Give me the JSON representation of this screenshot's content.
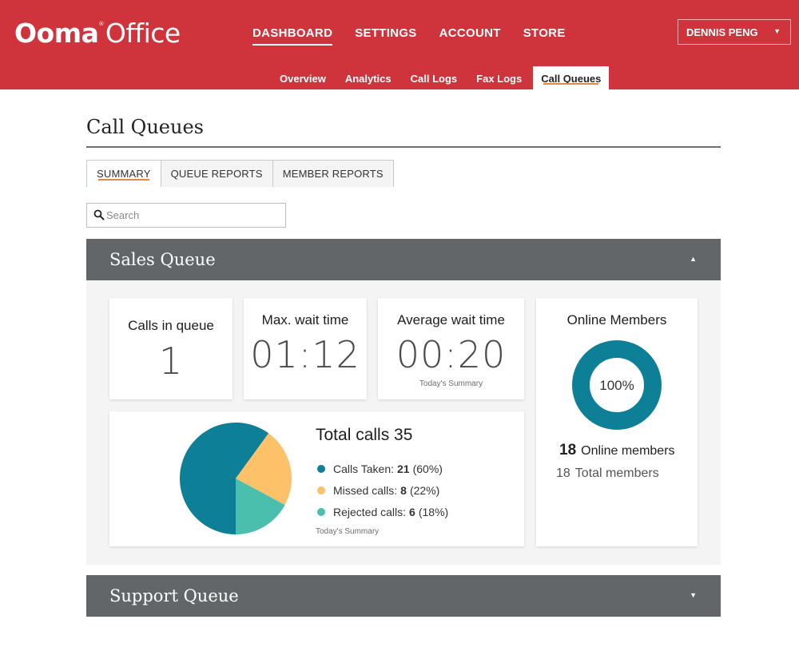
{
  "header": {
    "logo_brand": "Ooma",
    "logo_reg": "®",
    "logo_product": "Office",
    "main_nav": [
      {
        "label": "DASHBOARD",
        "active": true
      },
      {
        "label": "SETTINGS",
        "active": false
      },
      {
        "label": "ACCOUNT",
        "active": false
      },
      {
        "label": "STORE",
        "active": false
      }
    ],
    "user_menu": {
      "label": "DENNIS PENG",
      "caret": "▼"
    },
    "sub_nav": [
      {
        "label": "Overview",
        "active": false
      },
      {
        "label": "Analytics",
        "active": false
      },
      {
        "label": "Call Logs",
        "active": false
      },
      {
        "label": "Fax Logs",
        "active": false
      },
      {
        "label": "Call Queues",
        "active": true
      }
    ]
  },
  "page": {
    "title": "Call Queues",
    "tabs": [
      {
        "label": "SUMMARY",
        "active": true
      },
      {
        "label": "QUEUE REPORTS",
        "active": false
      },
      {
        "label": "MEMBER REPORTS",
        "active": false
      }
    ],
    "search": {
      "placeholder": "Search",
      "value": ""
    }
  },
  "queues": [
    {
      "name": "Sales Queue",
      "expanded": true,
      "toggle_icon": "▲",
      "stats": {
        "calls_in_queue": {
          "label": "Calls in queue",
          "value": "1"
        },
        "max_wait": {
          "label": "Max. wait time",
          "value": "01:12"
        },
        "avg_wait": {
          "label": "Average wait time",
          "value": "00:20",
          "note": "Today's Summary"
        }
      },
      "online_members": {
        "title": "Online Members",
        "percent_label": "100%",
        "online_fraction": 1.0,
        "online_count": "18",
        "online_label": "Online members",
        "total_count": "18",
        "total_label": "Total members",
        "ring_color": "#0d7f96"
      },
      "total_calls": {
        "title": "Total calls 35",
        "note": "Today's Summary",
        "legend": [
          {
            "label": "Calls Taken:",
            "count": "21",
            "pct": "(60%)",
            "color": "#0d7f96"
          },
          {
            "label": "Missed calls:",
            "count": "8",
            "pct": "(22%)",
            "color": "#fcc169"
          },
          {
            "label": "Rejected calls:",
            "count": "6",
            "pct": "(18%)",
            "color": "#4abfad"
          }
        ]
      }
    },
    {
      "name": "Support Queue",
      "expanded": false,
      "toggle_icon": "▼"
    }
  ],
  "chart_data": {
    "type": "pie",
    "title": "Total calls 35",
    "categories": [
      "Calls Taken",
      "Missed calls",
      "Rejected calls"
    ],
    "values": [
      21,
      8,
      6
    ],
    "percentages": [
      60,
      22,
      18
    ],
    "colors": [
      "#0d7f96",
      "#fcc169",
      "#4abfad"
    ],
    "legend": "right"
  },
  "colors": {
    "brand_red": "#cf333b",
    "accent_orange": "#e0883e",
    "queue_header": "#636669"
  }
}
